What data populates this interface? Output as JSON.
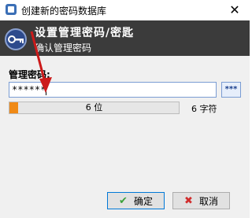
{
  "window": {
    "title": "创建新的密码数据库",
    "close_symbol": "✕"
  },
  "banner": {
    "title": "设置管理密码/密匙",
    "subtitle": "确认管理密码"
  },
  "form": {
    "password_label": "管理密码:",
    "password_value": "******",
    "toggle_label": "***",
    "quality_text": "6 位",
    "quality_fraction": 0.05,
    "char_count": "6 字符"
  },
  "buttons": {
    "ok_label": "确定",
    "cancel_label": "取消"
  },
  "colors": {
    "banner_bg": "#3b3b3b",
    "quality_fill": "#f08a16",
    "annotation_arrow": "#cc1a1a"
  },
  "icons": {
    "app": "app-icon",
    "key": "key-icon",
    "ok": "check-icon",
    "cancel": "x-icon"
  }
}
